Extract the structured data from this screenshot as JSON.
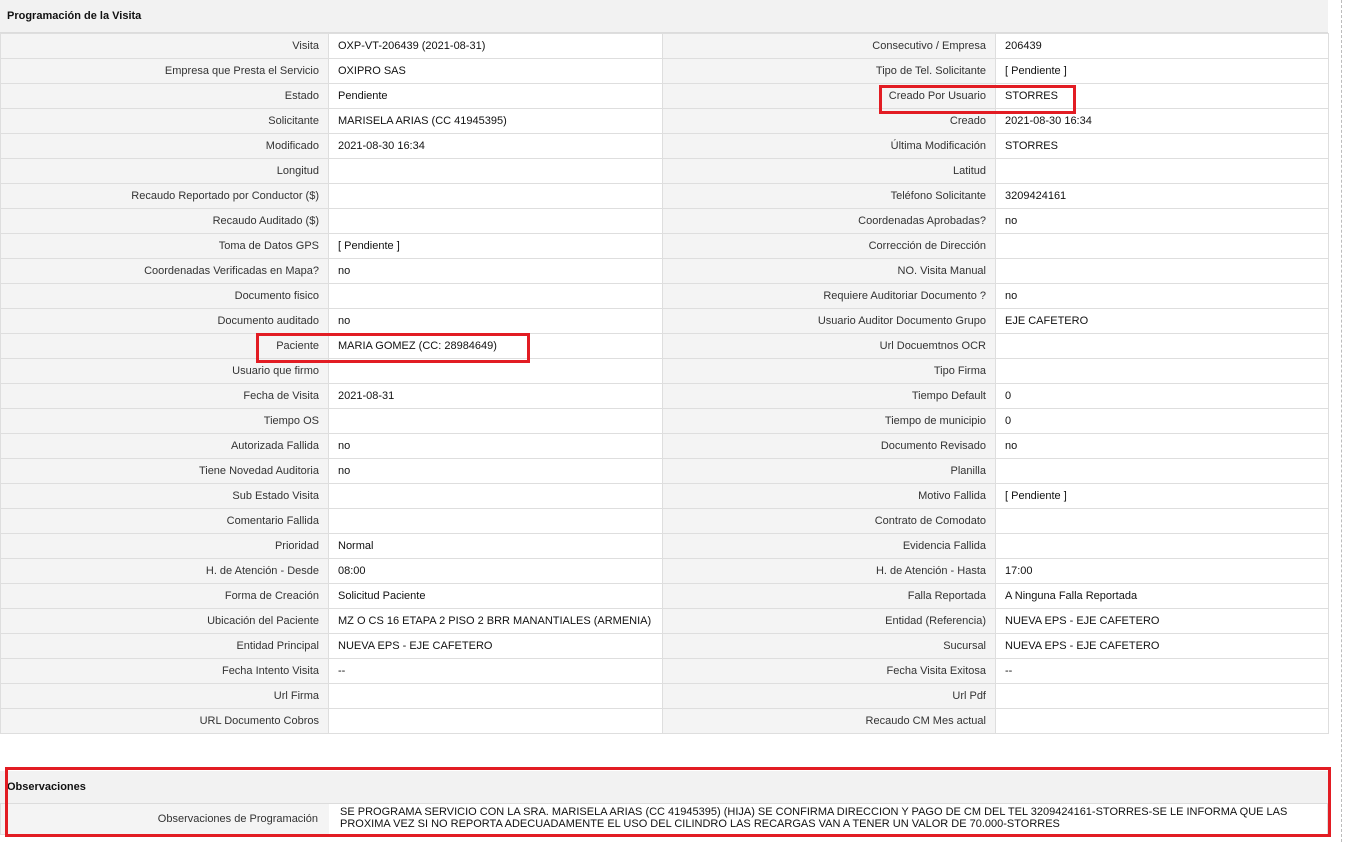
{
  "section_title": "Programación de la Visita",
  "rows": [
    [
      "Visita",
      "OXP-VT-206439 (2021-08-31)",
      "Consecutivo / Empresa",
      "206439"
    ],
    [
      "Empresa que Presta el Servicio",
      "OXIPRO SAS",
      "Tipo de Tel. Solicitante",
      "[ Pendiente ]"
    ],
    [
      "Estado",
      "Pendiente",
      "Creado Por Usuario",
      "STORRES"
    ],
    [
      "Solicitante",
      "MARISELA ARIAS (CC 41945395)",
      "Creado",
      "2021-08-30 16:34"
    ],
    [
      "Modificado",
      "2021-08-30 16:34",
      "Última Modificación",
      " STORRES"
    ],
    [
      "Longitud",
      "",
      "Latitud",
      ""
    ],
    [
      "Recaudo Reportado por Conductor ($)",
      "",
      "Teléfono Solicitante",
      "3209424161"
    ],
    [
      "Recaudo Auditado ($)",
      "",
      "Coordenadas Aprobadas?",
      " no"
    ],
    [
      "Toma de Datos GPS",
      "[ Pendiente ]",
      "Corrección de Dirección",
      ""
    ],
    [
      "Coordenadas Verificadas en Mapa?",
      " no",
      "NO. Visita Manual",
      ""
    ],
    [
      "Documento fisico",
      "",
      "Requiere Auditoriar Documento ?",
      " no"
    ],
    [
      "Documento auditado",
      " no",
      "Usuario Auditor Documento Grupo",
      "EJE CAFETERO"
    ],
    [
      "Paciente",
      "MARIA GOMEZ (CC: 28984649)",
      "Url Docuemtnos OCR",
      ""
    ],
    [
      "Usuario que firmo",
      "",
      "Tipo Firma",
      ""
    ],
    [
      "Fecha de Visita",
      " 2021-08-31",
      "Tiempo Default",
      "0"
    ],
    [
      "Tiempo OS",
      "",
      "Tiempo de municipio",
      "0"
    ],
    [
      "Autorizada Fallida",
      " no",
      "Documento Revisado",
      " no"
    ],
    [
      "Tiene Novedad Auditoria",
      " no",
      "Planilla",
      ""
    ],
    [
      "Sub Estado Visita",
      "",
      "Motivo Fallida",
      "[ Pendiente ]"
    ],
    [
      "Comentario Fallida",
      "",
      "Contrato de Comodato",
      ""
    ],
    [
      "Prioridad",
      "Normal",
      "Evidencia Fallida",
      ""
    ],
    [
      "H. de Atención - Desde",
      "08:00",
      "H. de Atención - Hasta",
      "17:00"
    ],
    [
      "Forma de Creación",
      "Solicitud Paciente",
      "Falla Reportada",
      "A Ninguna Falla Reportada"
    ],
    [
      "Ubicación del Paciente",
      "MZ O CS 16 ETAPA 2 PISO 2 BRR MANANTIALES (ARMENIA)",
      "Entidad (Referencia)",
      "NUEVA EPS - EJE CAFETERO"
    ],
    [
      "Entidad Principal",
      "NUEVA EPS - EJE CAFETERO",
      "Sucursal",
      "NUEVA EPS - EJE CAFETERO"
    ],
    [
      "Fecha Intento Visita",
      " --",
      "Fecha Visita Exitosa",
      " --"
    ],
    [
      "Url Firma",
      "",
      "Url Pdf",
      ""
    ],
    [
      "URL Documento Cobros",
      "",
      "Recaudo CM Mes actual",
      ""
    ]
  ],
  "observations": {
    "title": "Observaciones",
    "label": "Observaciones de Programación",
    "text": " SE PROGRAMA SERVICIO CON LA SRA. MARISELA ARIAS (CC 41945395) (HIJA) SE CONFIRMA DIRECCION Y PAGO DE CM DEL TEL 3209424161-STORRES-SE LE INFORMA QUE LAS PROXIMA VEZ SI NO REPORTA ADECUADAMENTE EL USO DEL CILINDRO LAS RECARGAS VAN A TENER UN VALOR DE 70.000-STORRES"
  },
  "highlight_color": "#e21c23"
}
